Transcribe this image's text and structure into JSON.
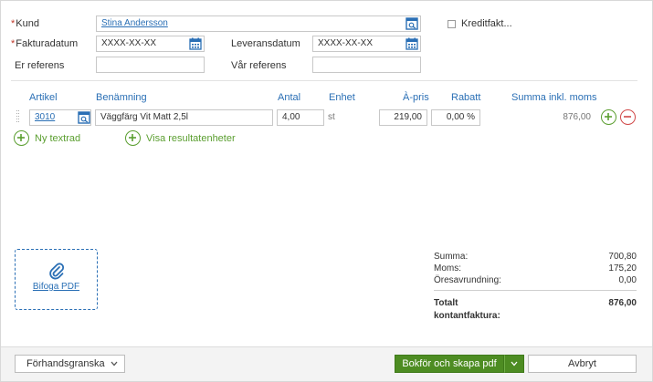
{
  "header": {
    "kund_label": "Kund",
    "kund_value": "Stina Andersson",
    "kreditfakt_label": "Kreditfakt...",
    "fakturadatum_label": "Fakturadatum",
    "fakturadatum_value": "XXXX-XX-XX",
    "leveransdatum_label": "Leveransdatum",
    "leveransdatum_value": "XXXX-XX-XX",
    "er_referens_label": "Er referens",
    "er_referens_value": "",
    "var_referens_label": "Vår referens",
    "var_referens_value": ""
  },
  "table": {
    "columns": [
      "Artikel",
      "Benämning",
      "Antal",
      "Enhet",
      "À-pris",
      "Rabatt",
      "Summa inkl. moms"
    ],
    "rows": [
      {
        "artikel": "3010",
        "benamning": "Väggfärg Vit Matt 2,5l",
        "antal": "4,00",
        "enhet": "st",
        "apris": "219,00",
        "rabatt": "0,00 %",
        "summa": "876,00"
      }
    ]
  },
  "actions": {
    "ny_textrad": "Ny textrad",
    "visa_resultatenheter": "Visa resultatenheter",
    "bifoga_pdf": "Bifoga PDF"
  },
  "summary": {
    "summa_label": "Summa:",
    "summa_value": "700,80",
    "moms_label": "Moms:",
    "moms_value": "175,20",
    "oresavrundning_label": "Öresavrundning:",
    "oresavrundning_value": "0,00",
    "totalt_label_1": "Totalt",
    "totalt_label_2": "kontantfaktura:",
    "totalt_value": "876,00"
  },
  "footer": {
    "preview_label": "Förhandsgranska",
    "book_label": "Bokför och skapa pdf",
    "cancel_label": "Avbryt"
  },
  "colors": {
    "link": "#2a6fb5",
    "green": "#5a9e2f",
    "primary": "#4d8c22",
    "required": "#c0392b",
    "remove": "#d04848"
  }
}
